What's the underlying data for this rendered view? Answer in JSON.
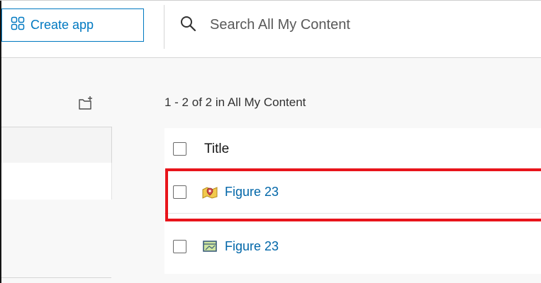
{
  "header": {
    "create_app_label": "Create app",
    "search_placeholder": "Search All My Content"
  },
  "content": {
    "count_text": "1 - 2 of 2 in All My Content",
    "table": {
      "title_header": "Title",
      "rows": [
        {
          "title": "Figure 23",
          "icon": "map-pin-icon"
        },
        {
          "title": "Figure 23",
          "icon": "web-map-icon"
        }
      ]
    }
  },
  "colors": {
    "accent": "#0079c1",
    "link": "#0066a8",
    "highlight": "#e8141b"
  }
}
